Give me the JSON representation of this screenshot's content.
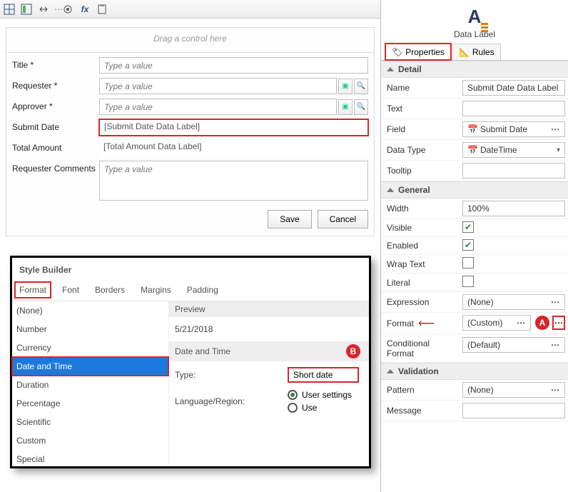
{
  "toolbar": {
    "icons": [
      "grid-icon",
      "layout-icon",
      "arrows-icon",
      "dots-icon",
      "gear-icon",
      "fx-icon",
      "clipboard-icon"
    ]
  },
  "canvas": {
    "drag_hint": "Drag a control here",
    "rows": [
      {
        "label": "Title *",
        "placeholder": "Type a value",
        "type": "text"
      },
      {
        "label": "Requester *",
        "placeholder": "Type a value",
        "type": "picker"
      },
      {
        "label": "Approver *",
        "placeholder": "Type a value",
        "type": "picker"
      },
      {
        "label": "Submit Date",
        "value": "[Submit Date Data Label]",
        "type": "readonly",
        "highlight": true
      },
      {
        "label": "Total Amount",
        "value": "[Total Amount Data Label]",
        "type": "readonly"
      },
      {
        "label": "Requester Comments",
        "placeholder": "Type a value",
        "type": "textarea"
      }
    ],
    "buttons": {
      "save": "Save",
      "cancel": "Cancel"
    }
  },
  "style_builder": {
    "title": "Style Builder",
    "tabs": [
      "Format",
      "Font",
      "Borders",
      "Margins",
      "Padding"
    ],
    "active_tab": 0,
    "list": [
      "(None)",
      "Number",
      "Currency",
      "Date and Time",
      "Duration",
      "Percentage",
      "Scientific",
      "Custom",
      "Special"
    ],
    "selected_index": 3,
    "preview_label": "Preview",
    "preview_value": "5/21/2018",
    "subhead": "Date and Time",
    "badge": "B",
    "type_label": "Type:",
    "type_value": "Short date",
    "lang_label": "Language/Region:",
    "lang_opts": [
      "User settings",
      "Use"
    ],
    "lang_selected": 0
  },
  "properties": {
    "component_label": "Data Label",
    "tabs": [
      {
        "label": "Properties",
        "icon": "properties-icon"
      },
      {
        "label": "Rules",
        "icon": "rules-icon"
      }
    ],
    "active_tab": 0,
    "sections": {
      "detail": {
        "title": "Detail",
        "rows": [
          {
            "key": "Name",
            "value": "Submit Date Data Label",
            "control": "text"
          },
          {
            "key": "Text",
            "value": "",
            "control": "text"
          },
          {
            "key": "Field",
            "value": "Submit Date",
            "control": "picker",
            "icon": "calendar-icon"
          },
          {
            "key": "Data Type",
            "value": "DateTime",
            "control": "dropdown",
            "icon": "calendar-icon"
          },
          {
            "key": "Tooltip",
            "value": "",
            "control": "text"
          }
        ]
      },
      "general": {
        "title": "General",
        "rows": [
          {
            "key": "Width",
            "value": "100%",
            "control": "text"
          },
          {
            "key": "Visible",
            "value": true,
            "control": "check"
          },
          {
            "key": "Enabled",
            "value": true,
            "control": "check"
          },
          {
            "key": "Wrap Text",
            "value": false,
            "control": "check"
          },
          {
            "key": "Literal",
            "value": false,
            "control": "check"
          },
          {
            "key": "Expression",
            "value": "(None)",
            "control": "picker"
          },
          {
            "key": "Format",
            "value": "(Custom)",
            "control": "picker",
            "badge": "A",
            "arrow": true,
            "highlight_ell": true
          },
          {
            "key": "Conditional Format",
            "value": "(Default)",
            "control": "picker"
          }
        ]
      },
      "validation": {
        "title": "Validation",
        "rows": [
          {
            "key": "Pattern",
            "value": "(None)",
            "control": "picker"
          },
          {
            "key": "Message",
            "value": "",
            "control": "text"
          }
        ]
      }
    }
  }
}
